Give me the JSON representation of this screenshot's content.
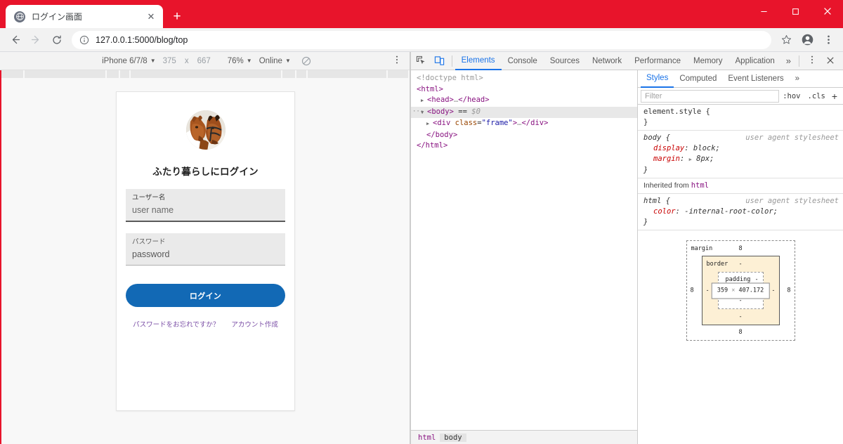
{
  "browser": {
    "tab": {
      "title": "ログイン画面",
      "favicon": "globe-icon",
      "close": "✕"
    },
    "newtab_label": "+",
    "window_controls": {
      "minimize": "—",
      "maximize": "▢",
      "close": "✕"
    },
    "toolbar": {
      "back": "←",
      "forward": "→",
      "reload": "⟳",
      "site_info_icon": "info-circle-icon",
      "url": "127.0.0.1:5000/blog/top",
      "bookmark": "☆",
      "profile": "account-icon",
      "menu": "⋮"
    },
    "accent_color": "#e8142b"
  },
  "device_toolbar": {
    "device": "iPhone 6/7/8",
    "width": "375",
    "separator": "x",
    "height": "667",
    "zoom": "76%",
    "network": "Online",
    "throttle_icon": "no-throttling-icon",
    "menu": "⋮"
  },
  "page": {
    "avatar_alt": "two-horses-photo",
    "title": "ふたり暮らしにログイン",
    "fields": [
      {
        "label": "ユーザー名",
        "value": "user name",
        "focused": true
      },
      {
        "label": "パスワード",
        "value": "password",
        "focused": false
      }
    ],
    "submit_label": "ログイン",
    "links": [
      {
        "label": "パスワードをお忘れですか？"
      },
      {
        "label": "アカウント作成"
      }
    ],
    "link_color": "#7b4fa6",
    "button_color": "#1269b5"
  },
  "devtools": {
    "toolbar_icons": {
      "inspect": "inspect-element-icon",
      "device": "device-toolbar-icon"
    },
    "tabs": [
      {
        "label": "Elements",
        "active": true
      },
      {
        "label": "Console",
        "active": false
      },
      {
        "label": "Sources",
        "active": false
      },
      {
        "label": "Network",
        "active": false
      },
      {
        "label": "Performance",
        "active": false
      },
      {
        "label": "Memory",
        "active": false
      },
      {
        "label": "Application",
        "active": false
      }
    ],
    "more_tabs": "»",
    "kebab": "⋮",
    "close": "✕",
    "dom_tree": [
      {
        "indent": 0,
        "text": "<!doctype html>",
        "kind": "doctype"
      },
      {
        "indent": 0,
        "text": "<html>",
        "kind": "tag"
      },
      {
        "indent": 1,
        "text": "<head>…</head>",
        "kind": "collapsed"
      },
      {
        "indent": 0,
        "text": "<body> == $0",
        "kind": "selected"
      },
      {
        "indent": 2,
        "text": "<div class=\"frame\">…</div>",
        "kind": "collapsed"
      },
      {
        "indent": 2,
        "text": "</body>",
        "kind": "tag"
      },
      {
        "indent": 0,
        "text": "</html>",
        "kind": "tag"
      }
    ],
    "breadcrumbs": [
      {
        "label": "html",
        "active": false
      },
      {
        "label": "body",
        "active": true
      }
    ],
    "styles": {
      "tabs": [
        {
          "label": "Styles",
          "active": true
        },
        {
          "label": "Computed",
          "active": false
        },
        {
          "label": "Event Listeners",
          "active": false
        }
      ],
      "more": "»",
      "filter_placeholder": "Filter",
      "hov_label": ":hov",
      "cls_label": ".cls",
      "plus_label": "+",
      "rules": [
        {
          "selector": "element.style {",
          "origin": "",
          "declarations": [],
          "close": "}"
        },
        {
          "selector": "body {",
          "origin": "user agent stylesheet",
          "declarations": [
            {
              "prop": "display",
              "value": "block;"
            },
            {
              "prop": "margin",
              "value": "8px;",
              "expandable": true
            }
          ],
          "close": "}"
        }
      ],
      "inherited_label": "Inherited from",
      "inherited_tag": "html",
      "inherited_rule": {
        "selector": "html {",
        "origin": "user agent stylesheet",
        "declarations": [
          {
            "prop": "color",
            "value": "-internal-root-color;"
          }
        ],
        "close": "}"
      }
    },
    "box_model": {
      "margin_label": "margin",
      "border_label": "border",
      "padding_label": "padding",
      "content": "359 × 407.172",
      "content_w": "359",
      "content_sep": "×",
      "content_h": "407.172",
      "margin_top": "8",
      "margin_right": "8",
      "margin_bottom": "8",
      "margin_left": "8",
      "border_top": "-",
      "border_right": "-",
      "border_bottom": "-",
      "border_left": "-",
      "padding_top": "-",
      "padding_right": "-",
      "padding_bottom": "-",
      "padding_left": "-"
    }
  }
}
